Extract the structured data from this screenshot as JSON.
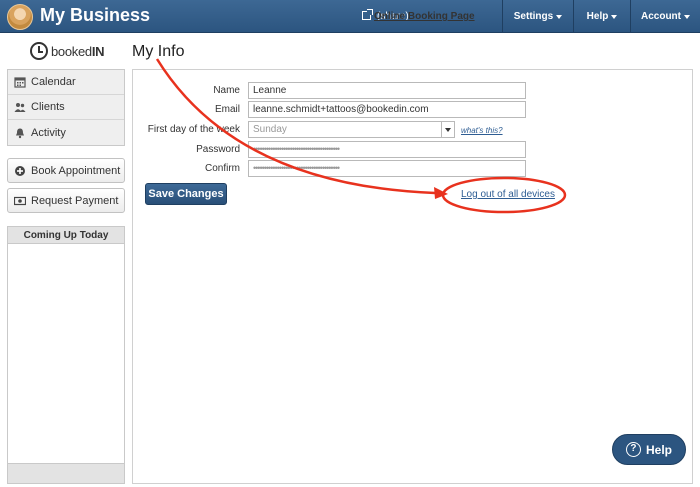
{
  "header": {
    "title": "My Business",
    "booking_link": "Online Booking Page",
    "share": "(share)",
    "menus": {
      "settings": "Settings",
      "help": "Help",
      "account": "Account"
    }
  },
  "sidebar": {
    "logo": {
      "prefix": "booked",
      "suffix": "IN"
    },
    "nav": [
      {
        "label": "Calendar",
        "icon": "calendar-icon"
      },
      {
        "label": "Clients",
        "icon": "clients-icon"
      },
      {
        "label": "Activity",
        "icon": "bell-icon"
      }
    ],
    "book_appointment": "Book Appointment",
    "request_payment": "Request Payment",
    "coming_up": "Coming Up Today"
  },
  "main": {
    "title": "My Info",
    "form": {
      "name_label": "Name",
      "name_value": "Leanne",
      "email_label": "Email",
      "email_value": "leanne.schmidt+tattoos@bookedin.com",
      "first_day_label": "First day of the week",
      "first_day_value": "Sunday",
      "whats_this": "what's this?",
      "password_label": "Password",
      "password_value": "••••••••••••••••••••••••••••••••••••••••",
      "confirm_label": "Confirm",
      "confirm_value": "••••••••••••••••••••••••••••••••••••••••"
    },
    "save_button": "Save Changes",
    "logout_link": "Log out of all devices"
  },
  "help_button": "Help",
  "colors": {
    "header": "#2c5580",
    "annotation": "#e8321e",
    "link": "#2e5d93"
  }
}
